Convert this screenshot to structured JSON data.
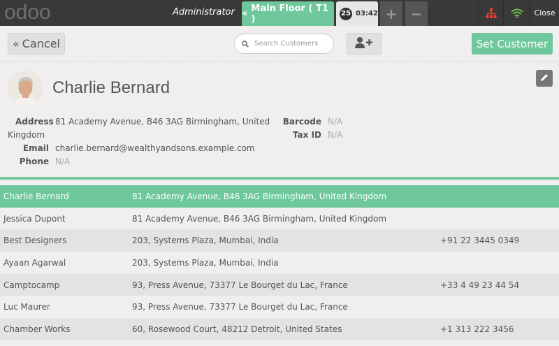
{
  "topbar": {
    "logo": "odoo",
    "username": "Administrator",
    "floor_label": "Main Floor ( T1 )",
    "order_number": "25",
    "order_time": "03:42",
    "plus_label": "+",
    "minus_label": "−",
    "close_label": "Close",
    "network_color": "#e8432e",
    "wifi_color": "#6cc24a"
  },
  "toolbar": {
    "cancel_label": "Cancel",
    "search_placeholder": "Search Customers",
    "set_customer_label": "Set Customer"
  },
  "customer_detail": {
    "name": "Charlie Bernard",
    "address_label": "Address",
    "address_line1": "81 Academy Avenue, B46 3AG Birmingham, United",
    "address_line2": "Kingdom",
    "email_label": "Email",
    "email": "charlie.bernard@wealthyandsons.example.com",
    "phone_label": "Phone",
    "phone": "N/A",
    "barcode_label": "Barcode",
    "barcode": "N/A",
    "taxid_label": "Tax ID",
    "taxid": "N/A"
  },
  "customers": [
    {
      "name": "Charlie Bernard",
      "address": "81 Academy Avenue, B46 3AG Birmingham, United Kingdom",
      "phone": ""
    },
    {
      "name": "Jessica Dupont",
      "address": "81 Academy Avenue, B46 3AG Birmingham, United Kingdom",
      "phone": ""
    },
    {
      "name": "Best Designers",
      "address": "203, Systems Plaza, Mumbai, India",
      "phone": "+91 22 3445 0349"
    },
    {
      "name": "Ayaan Agarwal",
      "address": "203, Systems Plaza, Mumbai, India",
      "phone": ""
    },
    {
      "name": "Camptocamp",
      "address": "93, Press Avenue, 73377 Le Bourget du Lac, France",
      "phone": "+33 4 49 23 44 54"
    },
    {
      "name": "Luc Maurer",
      "address": "93, Press Avenue, 73377 Le Bourget du Lac, France",
      "phone": ""
    },
    {
      "name": "Chamber Works",
      "address": "60, Rosewood Court, 48212 Detroit, United States",
      "phone": "+1 313 222 3456"
    }
  ],
  "colors": {
    "accent": "#6ec89b",
    "topbar": "#393939"
  }
}
